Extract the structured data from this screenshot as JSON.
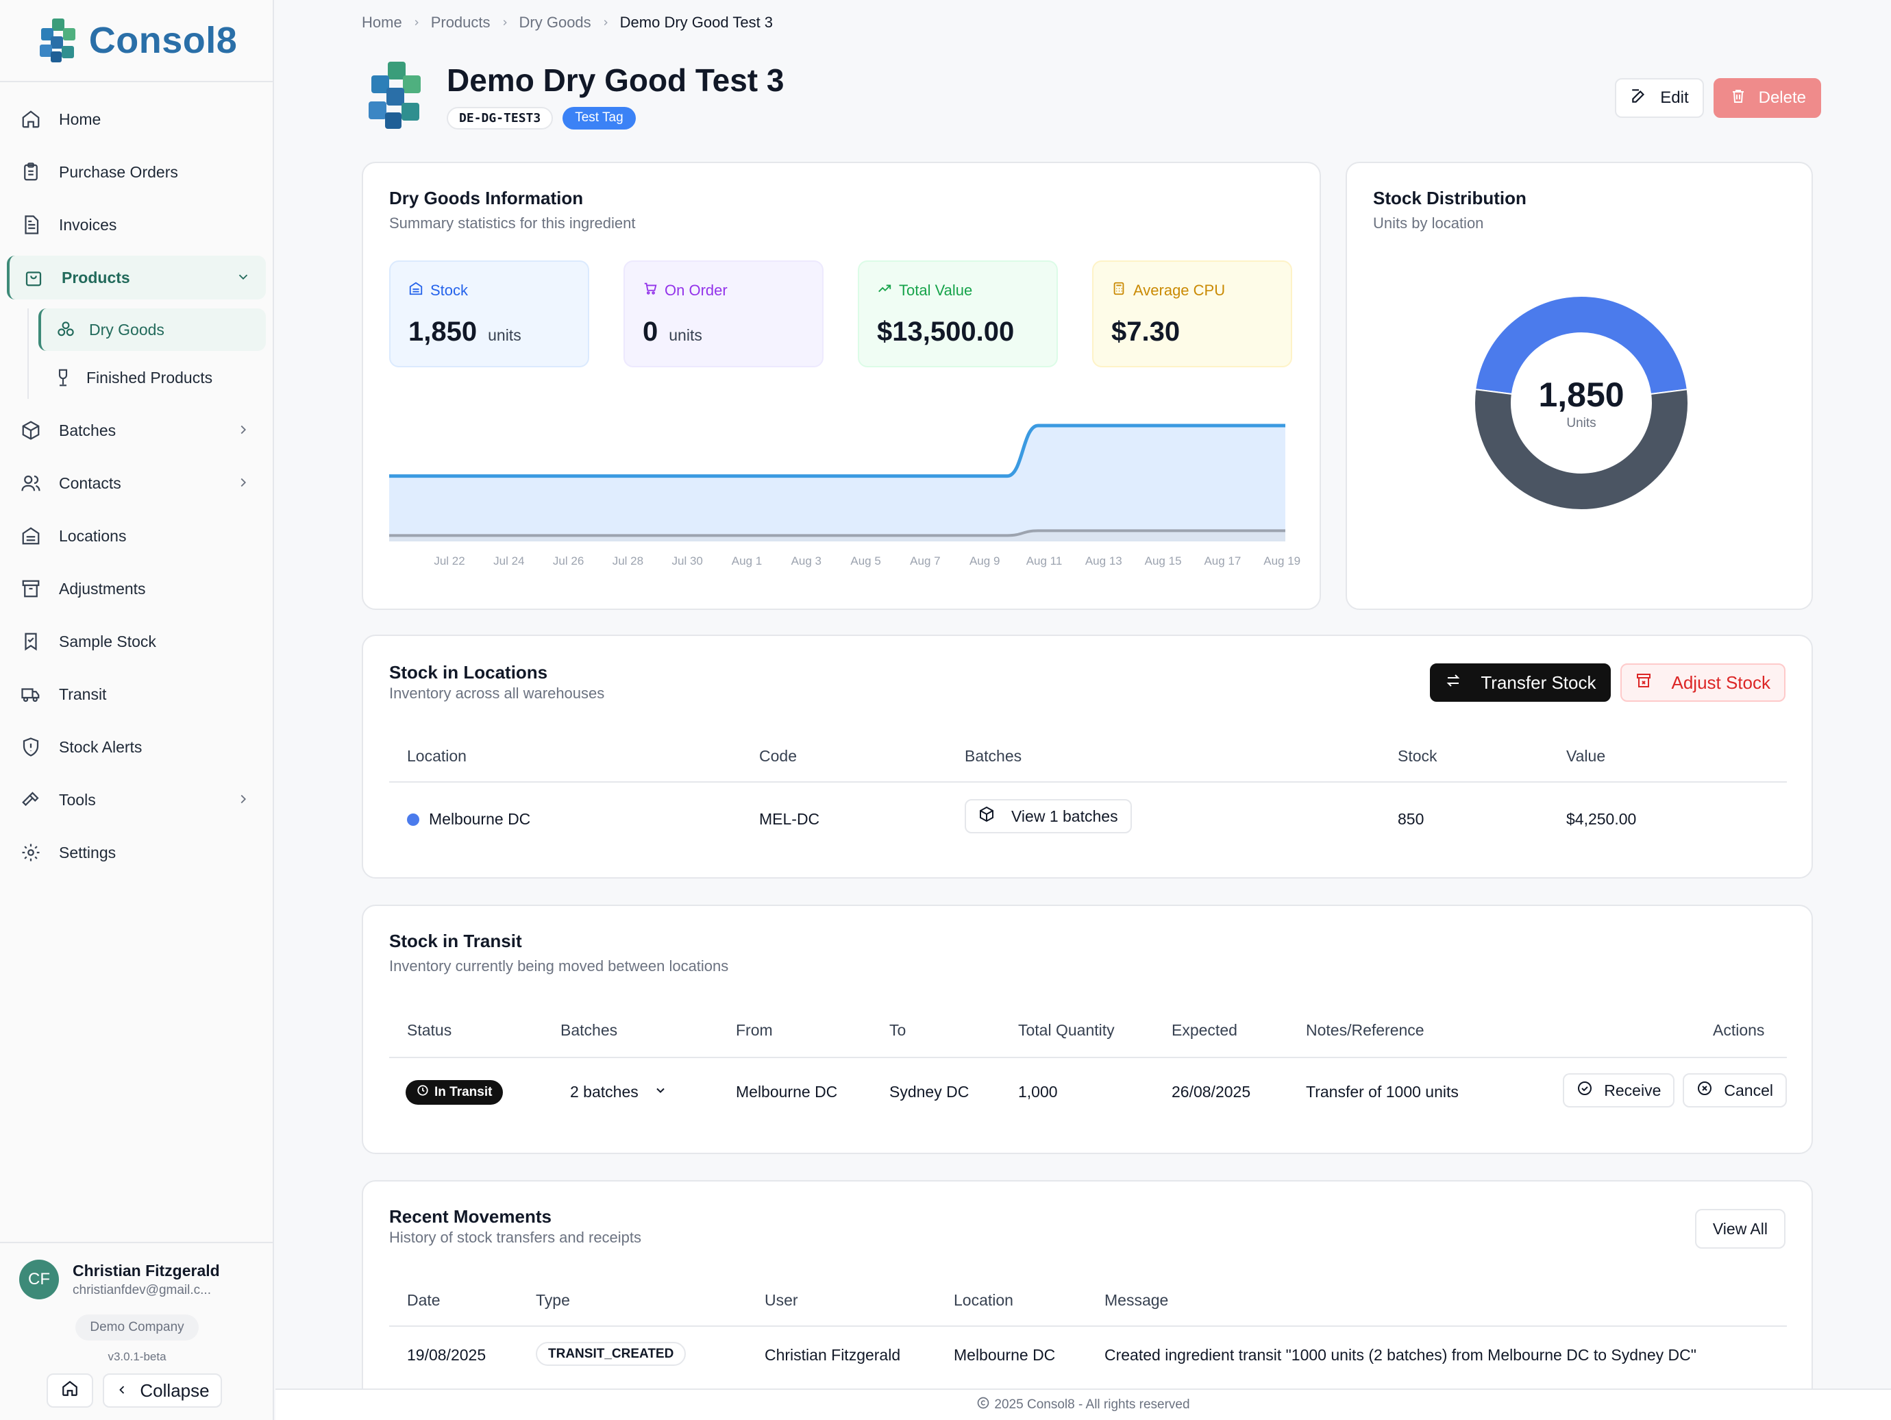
{
  "app": {
    "name": "Consol8",
    "logo_icon": "cube-cluster-logo"
  },
  "sidebar": {
    "items": [
      {
        "label": "Home",
        "icon": "home-icon"
      },
      {
        "label": "Purchase Orders",
        "icon": "clipboard-icon"
      },
      {
        "label": "Invoices",
        "icon": "document-icon"
      },
      {
        "label": "Products",
        "icon": "bag-icon",
        "expanded": true
      },
      {
        "label": "Batches",
        "icon": "box-icon"
      },
      {
        "label": "Contacts",
        "icon": "users-icon"
      },
      {
        "label": "Locations",
        "icon": "warehouse-icon"
      },
      {
        "label": "Adjustments",
        "icon": "archive-icon"
      },
      {
        "label": "Sample Stock",
        "icon": "bookmark-icon"
      },
      {
        "label": "Transit",
        "icon": "truck-icon"
      },
      {
        "label": "Stock Alerts",
        "icon": "shield-alert-icon"
      },
      {
        "label": "Tools",
        "icon": "hammer-icon"
      },
      {
        "label": "Settings",
        "icon": "gear-icon"
      }
    ],
    "sub_items": [
      {
        "label": "Dry Goods",
        "icon": "cubes-icon",
        "active": true
      },
      {
        "label": "Finished Products",
        "icon": "wine-glass-icon"
      }
    ],
    "user": {
      "initials": "CF",
      "name": "Christian Fitzgerald",
      "email": "christianfdev@gmail.c..."
    },
    "company": "Demo Company",
    "version": "v3.0.1-beta",
    "collapse_label": "Collapse"
  },
  "breadcrumb": [
    "Home",
    "Products",
    "Dry Goods",
    "Demo Dry Good Test 3"
  ],
  "product": {
    "title": "Demo Dry Good Test 3",
    "code": "DE-DG-TEST3",
    "tag": "Test Tag"
  },
  "actions": {
    "edit": "Edit",
    "delete": "Delete"
  },
  "info_card": {
    "title": "Dry Goods Information",
    "subtitle": "Summary statistics for this ingredient",
    "stats": [
      {
        "label": "Stock",
        "value": "1,850",
        "unit": "units",
        "color": "#2563eb",
        "bg": "#eff6ff",
        "border": "#dbeafe",
        "icon": "warehouse-icon"
      },
      {
        "label": "On Order",
        "value": "0",
        "unit": "units",
        "color": "#9333ea",
        "bg": "#f5f3ff",
        "border": "#ede9fe",
        "icon": "cart-icon"
      },
      {
        "label": "Total Value",
        "value": "$13,500.00",
        "unit": "",
        "color": "#16a34a",
        "bg": "#f0fdf4",
        "border": "#dcfce7",
        "icon": "trending-up-icon"
      },
      {
        "label": "Average CPU",
        "value": "$7.30",
        "unit": "",
        "color": "#ca8a04",
        "bg": "#fefce8",
        "border": "#fef3c7",
        "icon": "calculator-icon"
      }
    ]
  },
  "chart_data": [
    {
      "type": "area",
      "categories": [
        "Jul 22",
        "Jul 24",
        "Jul 26",
        "Jul 28",
        "Jul 30",
        "Aug 1",
        "Aug 3",
        "Aug 5",
        "Aug 7",
        "Aug 9",
        "Aug 11",
        "Aug 13",
        "Aug 15",
        "Aug 17",
        "Aug 19"
      ],
      "x_dates": [
        "Jul 22",
        "Jul 23",
        "Jul 24",
        "Jul 25",
        "Jul 26",
        "Jul 27",
        "Jul 28",
        "Jul 29",
        "Jul 30",
        "Jul 31",
        "Aug 1",
        "Aug 2",
        "Aug 3",
        "Aug 4",
        "Aug 5",
        "Aug 6",
        "Aug 7",
        "Aug 8",
        "Aug 9",
        "Aug 10",
        "Aug 11",
        "Aug 12",
        "Aug 13",
        "Aug 14",
        "Aug 15",
        "Aug 16",
        "Aug 17",
        "Aug 18",
        "Aug 19",
        "Aug 20"
      ],
      "series": [
        {
          "values": [
            1000,
            1000,
            1000,
            1000,
            1000,
            1000,
            1000,
            1000,
            1000,
            1000,
            1000,
            1000,
            1000,
            1000,
            1000,
            1000,
            1000,
            1000,
            1000,
            1000,
            1000,
            1850,
            1850,
            1850,
            1850,
            1850,
            1850,
            1850,
            1850,
            1850
          ],
          "color": "#3b9ae1"
        },
        {
          "values": [
            0,
            0,
            0,
            0,
            0,
            0,
            0,
            0,
            0,
            0,
            0,
            0,
            0,
            0,
            0,
            0,
            0,
            0,
            0,
            0,
            0,
            80,
            80,
            80,
            80,
            80,
            80,
            80,
            80,
            80
          ],
          "color": "#9ca3af"
        }
      ],
      "ylim": [
        -100,
        2000
      ],
      "grid": false
    },
    {
      "type": "pie",
      "title": "Stock Distribution",
      "subtitle": "Units by location",
      "center_value": "1,850",
      "center_label": "Units",
      "slices": [
        {
          "value": 850,
          "color": "#4b7bec"
        },
        {
          "value": 1000,
          "color": "#4b5563"
        }
      ]
    }
  ],
  "locations": {
    "title": "Stock in Locations",
    "subtitle": "Inventory across all warehouses",
    "transfer_label": "Transfer Stock",
    "adjust_label": "Adjust Stock",
    "headers": [
      "Location",
      "Code",
      "Batches",
      "Stock",
      "Value"
    ],
    "rows": [
      {
        "location": "Melbourne DC",
        "dot_color": "#4b7bec",
        "code": "MEL-DC",
        "batches": "View 1 batches",
        "stock": "850",
        "value": "$4,250.00"
      }
    ]
  },
  "transit": {
    "title": "Stock in Transit",
    "subtitle": "Inventory currently being moved between locations",
    "headers": [
      "Status",
      "Batches",
      "From",
      "To",
      "Total Quantity",
      "Expected",
      "Notes/Reference",
      "Actions"
    ],
    "rows": [
      {
        "status": "In Transit",
        "batches": "2 batches",
        "from": "Melbourne DC",
        "to": "Sydney DC",
        "qty": "1,000",
        "expected": "26/08/2025",
        "notes": "Transfer of 1000 units",
        "receive": "Receive",
        "cancel": "Cancel"
      }
    ]
  },
  "movements": {
    "title": "Recent Movements",
    "subtitle": "History of stock transfers and receipts",
    "view_all": "View All",
    "headers": [
      "Date",
      "Type",
      "User",
      "Location",
      "Message"
    ],
    "rows": [
      {
        "date": "19/08/2025",
        "type": "TRANSIT_CREATED",
        "user": "Christian Fitzgerald",
        "location": "Melbourne DC",
        "message": "Created ingredient transit \"1000 units (2 batches) from Melbourne DC to Sydney DC\""
      }
    ]
  },
  "footer": "2025 Consol8 - All rights reserved"
}
